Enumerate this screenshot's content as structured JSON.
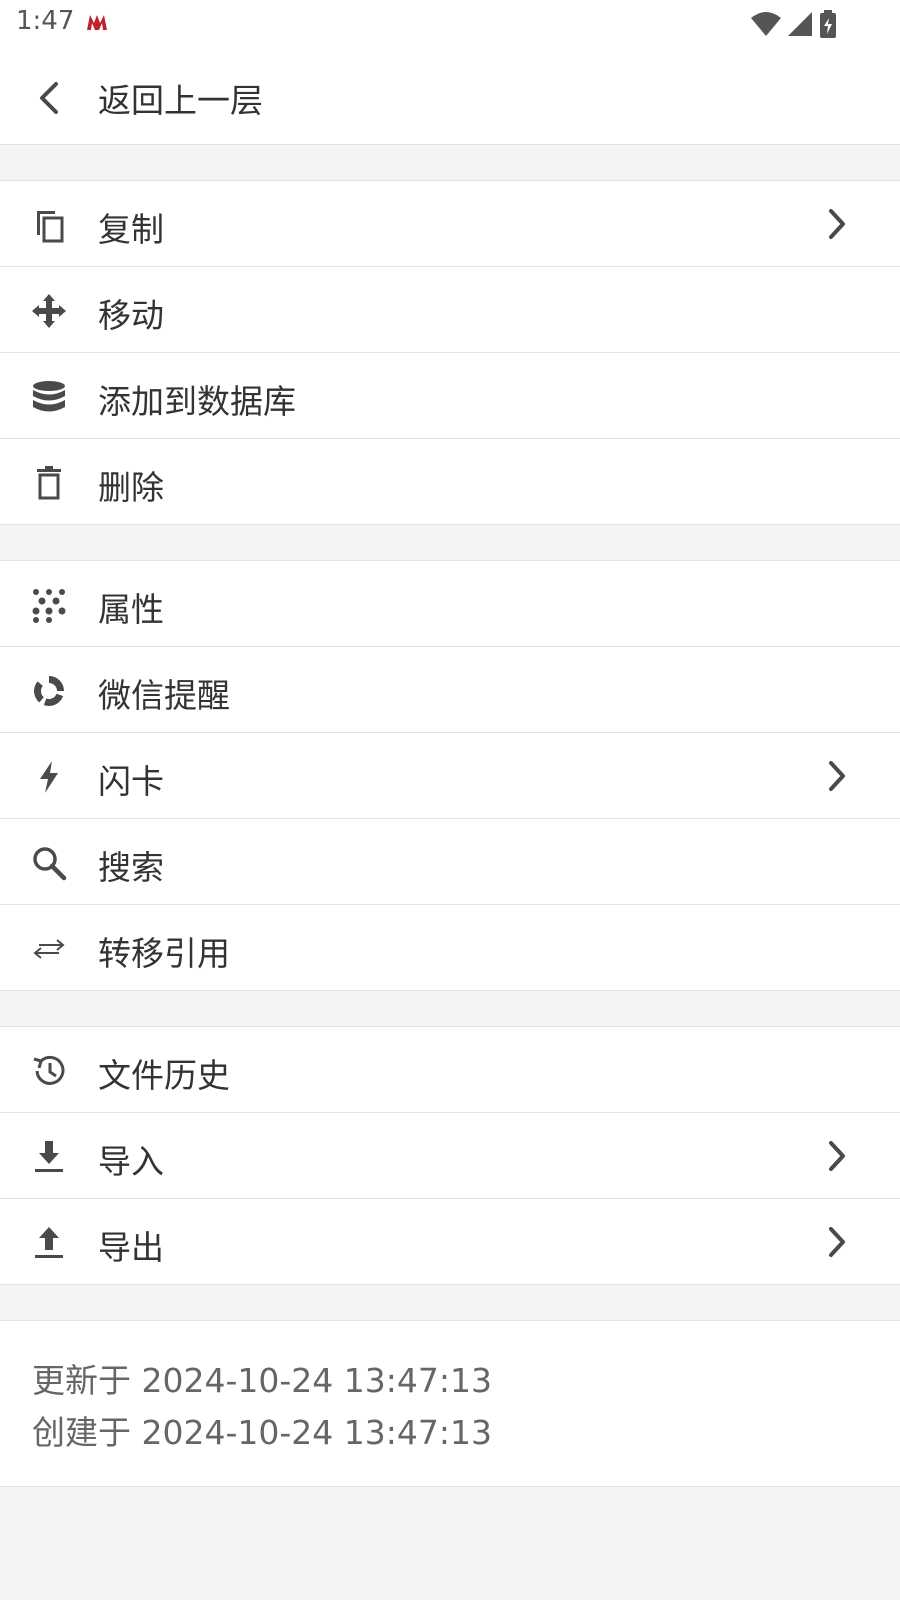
{
  "status_bar": {
    "time": "1:47"
  },
  "header": {
    "title": "返回上一层"
  },
  "menu": {
    "group1": [
      {
        "label": "复制",
        "icon": "copy-icon",
        "has_chevron": true
      },
      {
        "label": "移动",
        "icon": "move-icon",
        "has_chevron": false
      },
      {
        "label": "添加到数据库",
        "icon": "database-icon",
        "has_chevron": false
      },
      {
        "label": "删除",
        "icon": "trash-icon",
        "has_chevron": false
      }
    ],
    "group2": [
      {
        "label": "属性",
        "icon": "dots-grid-icon",
        "has_chevron": false
      },
      {
        "label": "微信提醒",
        "icon": "wechat-reminder-icon",
        "has_chevron": false
      },
      {
        "label": "闪卡",
        "icon": "lightning-icon",
        "has_chevron": true
      },
      {
        "label": "搜索",
        "icon": "search-icon",
        "has_chevron": false
      },
      {
        "label": "转移引用",
        "icon": "transfer-arrows-icon",
        "has_chevron": false
      }
    ],
    "group3": [
      {
        "label": "文件历史",
        "icon": "history-icon",
        "has_chevron": false
      },
      {
        "label": "导入",
        "icon": "import-icon",
        "has_chevron": true
      },
      {
        "label": "导出",
        "icon": "export-icon",
        "has_chevron": true
      }
    ]
  },
  "meta": {
    "updated": "更新于 2024-10-24 13:47:13",
    "created": "创建于 2024-10-24 13:47:13"
  },
  "colors": {
    "icon": "#4a4a4a",
    "text": "#333333",
    "muted_text": "#666666",
    "divider": "#e2e2e2",
    "background": "#f4f4f4"
  }
}
